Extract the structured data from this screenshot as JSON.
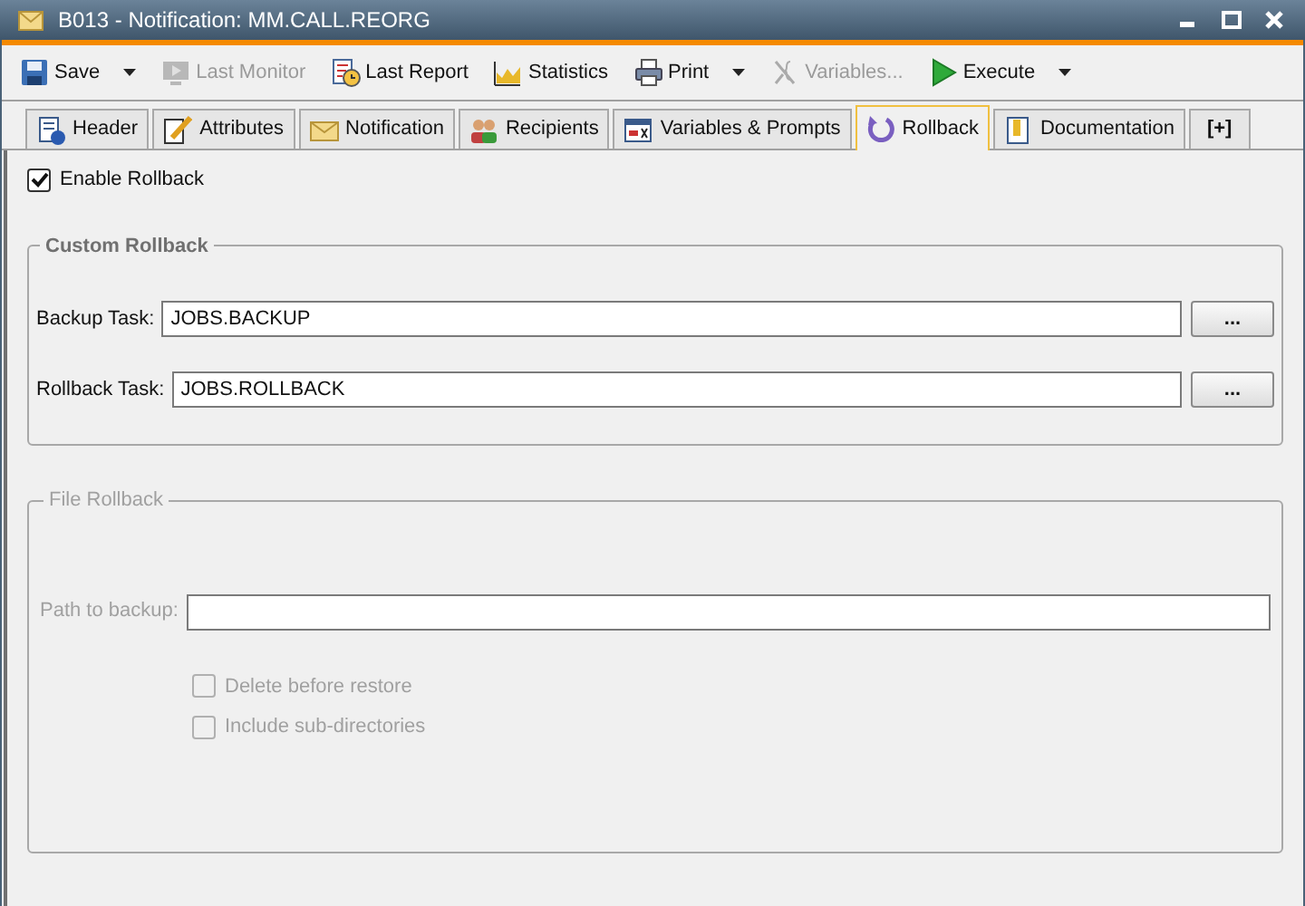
{
  "window": {
    "title": "B013 - Notification: MM.CALL.REORG"
  },
  "toolbar": [
    {
      "label": "Save",
      "disabled": false,
      "dropdown": true
    },
    {
      "label": "Last Monitor",
      "disabled": true,
      "dropdown": false
    },
    {
      "label": "Last Report",
      "disabled": false,
      "dropdown": false
    },
    {
      "label": "Statistics",
      "disabled": false,
      "dropdown": false
    },
    {
      "label": "Print",
      "disabled": false,
      "dropdown": true
    },
    {
      "label": "Variables...",
      "disabled": true,
      "dropdown": false
    },
    {
      "label": "Execute",
      "disabled": false,
      "dropdown": true
    }
  ],
  "tabs": [
    {
      "label": "Header",
      "selected": false
    },
    {
      "label": "Attributes",
      "selected": false
    },
    {
      "label": "Notification",
      "selected": false
    },
    {
      "label": "Recipients",
      "selected": false
    },
    {
      "label": "Variables & Prompts",
      "selected": false
    },
    {
      "label": "Rollback",
      "selected": true
    },
    {
      "label": "Documentation",
      "selected": false
    },
    {
      "label": "[+]",
      "selected": false
    }
  ],
  "enable_rollback": {
    "label": "Enable Rollback",
    "checked": true
  },
  "custom_rollback": {
    "title": "Custom Rollback",
    "fields": [
      {
        "label": "Backup Task:",
        "value": "JOBS.BACKUP",
        "button": "..."
      },
      {
        "label": "Rollback Task:",
        "value": "JOBS.ROLLBACK",
        "button": "..."
      }
    ]
  },
  "file_rollback": {
    "title": "File Rollback",
    "disabled": true,
    "path": {
      "label": "Path to backup:"
    },
    "options": [
      {
        "label": "Delete before restore",
        "checked": false,
        "disabled": true
      },
      {
        "label": "Include sub-directories",
        "checked": false,
        "disabled": true
      }
    ]
  }
}
